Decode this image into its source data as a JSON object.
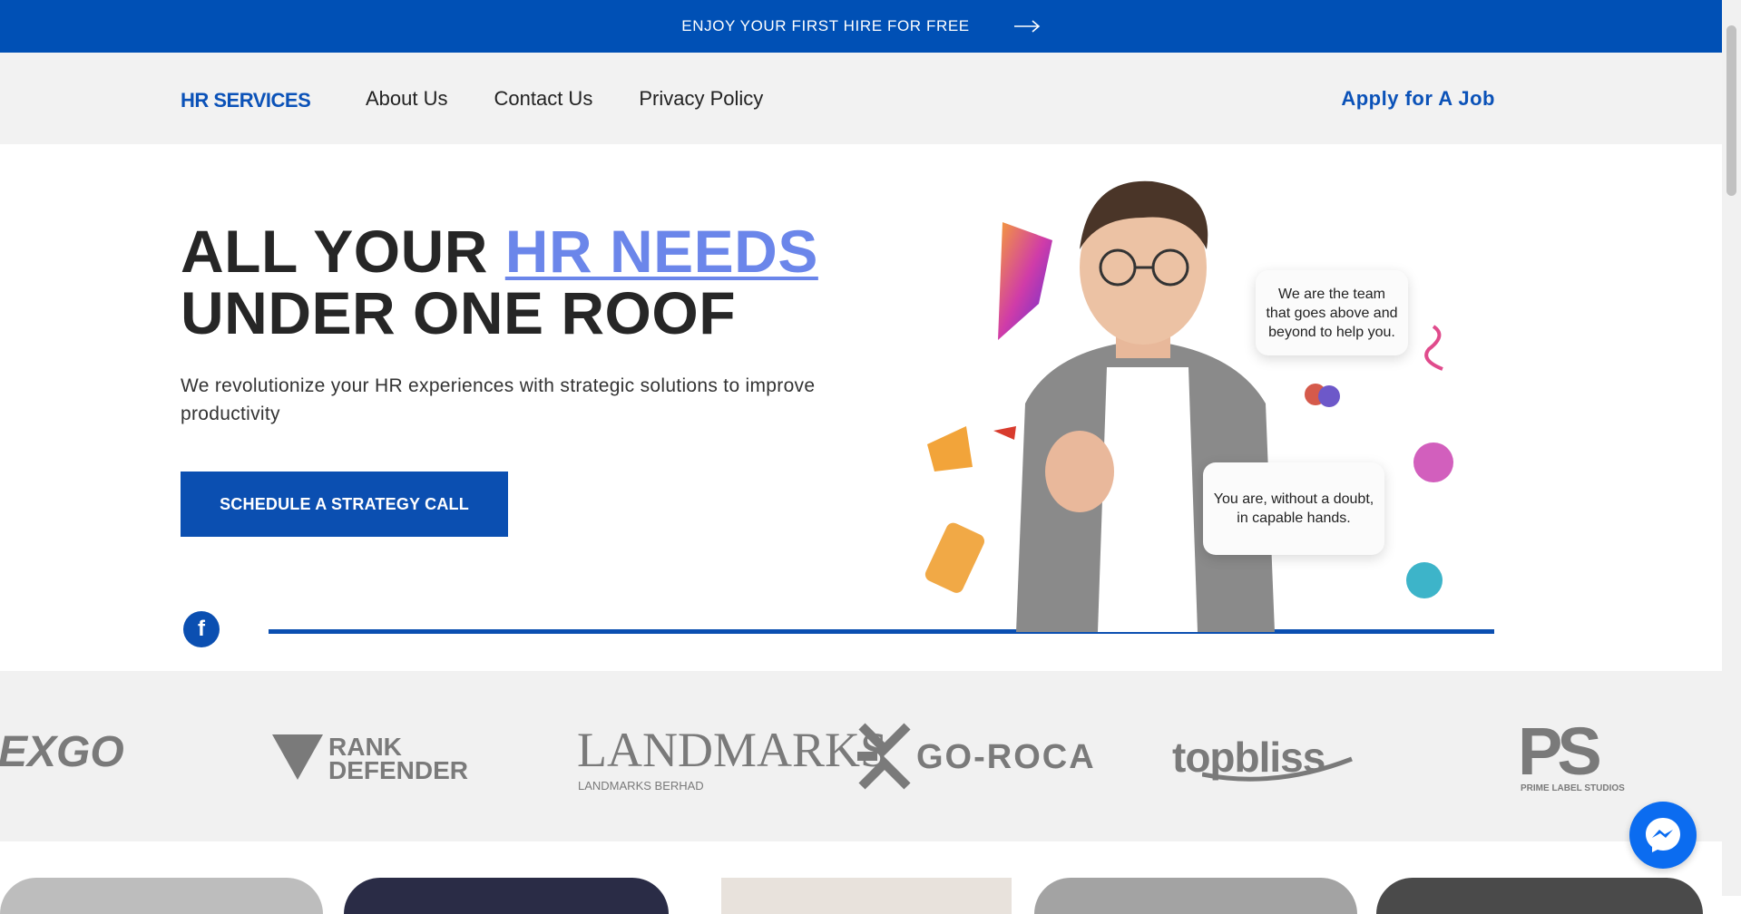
{
  "promo": {
    "text": "ENJOY YOUR FIRST HIRE FOR FREE",
    "icon": "arrow-right-icon"
  },
  "header": {
    "logo": "HR SERVICES",
    "nav": [
      "About Us",
      "Contact Us",
      "Privacy Policy"
    ],
    "apply": "Apply for A Job"
  },
  "hero": {
    "title_part1": "ALL YOUR ",
    "title_highlight": "HR NEEDS",
    "title_line2": "UNDER ONE ROOF",
    "subtitle": "We revolutionize your HR experiences with strategic solutions to improve productivity",
    "cta": "SCHEDULE A STRATEGY CALL",
    "bubble1": "We are the team that goes above and beyond to help you.",
    "bubble2": "You are, without a doubt, in capable hands."
  },
  "social": {
    "facebook": "f"
  },
  "logos": {
    "nexgo": "EXGO",
    "rank_defender_1": "RANK",
    "rank_defender_2": "DEFENDER",
    "landmarks": "LANDMARKS",
    "landmarks_sub": "LANDMARKS BERHAD",
    "goroca": "GO-ROCA",
    "topbliss": "topbliss",
    "prime_label": "PS",
    "prime_label_sub": "PRIME LABEL STUDIOS"
  },
  "colors": {
    "primary": "#0050b5",
    "highlight": "#6b86ea",
    "messenger": "#0b6cf0"
  }
}
